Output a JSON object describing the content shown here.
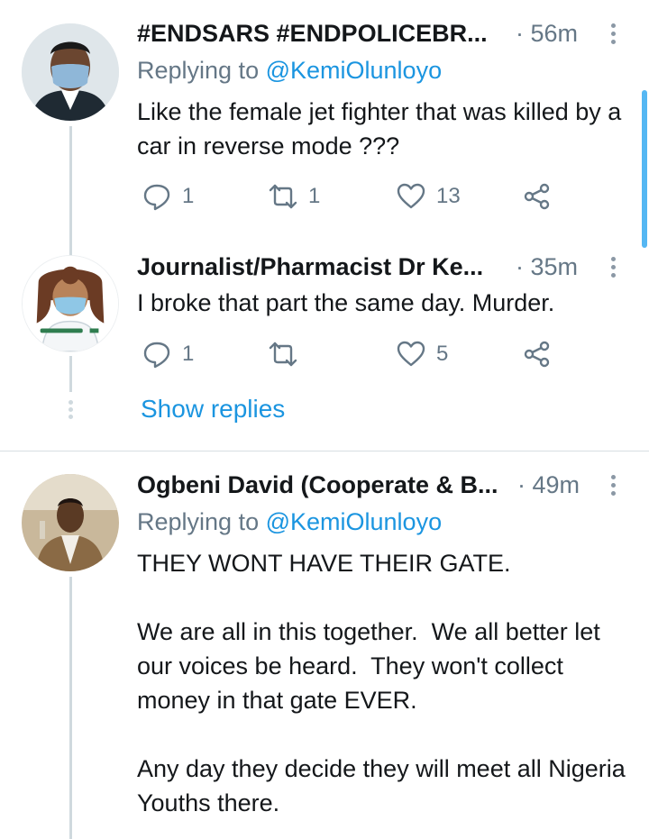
{
  "tweets": [
    {
      "name": "#ENDSARS #ENDPOLICEBR...",
      "time": "· 56m",
      "replying_prefix": "Replying to ",
      "replying_handle": "@KemiOlunloyo",
      "text": "Like the female jet fighter that was killed by a car in reverse mode ???",
      "replies": "1",
      "retweets": "1",
      "likes": "13",
      "avatar_icon": "masked-man-avatar"
    },
    {
      "name": "Journalist/Pharmacist Dr Ke...",
      "time": "· 35m",
      "text": "I broke that part the same day. Murder.",
      "replies": "1",
      "retweets": "",
      "likes": "5",
      "avatar_icon": "cartoon-pharmacist-avatar"
    },
    {
      "name": "Ogbeni David (Cooperate & B...",
      "time": "· 49m",
      "replying_prefix": "Replying to ",
      "replying_handle": "@KemiOlunloyo",
      "text": "THEY WONT HAVE THEIR GATE.\n\nWe are all in this together.  We all better let our voices be heard.  They won't collect money in that gate EVER.\n\nAny day they decide they will meet all Nigeria Youths there.",
      "avatar_icon": "man-in-suit-avatar"
    }
  ],
  "show_replies": "Show replies",
  "colors": {
    "link": "#1b95e0",
    "muted": "#657786",
    "text": "#14171a",
    "thread_line": "#cfd9de"
  },
  "icons": [
    "reply-icon",
    "retweet-icon",
    "like-icon",
    "share-icon",
    "more-options-icon"
  ]
}
